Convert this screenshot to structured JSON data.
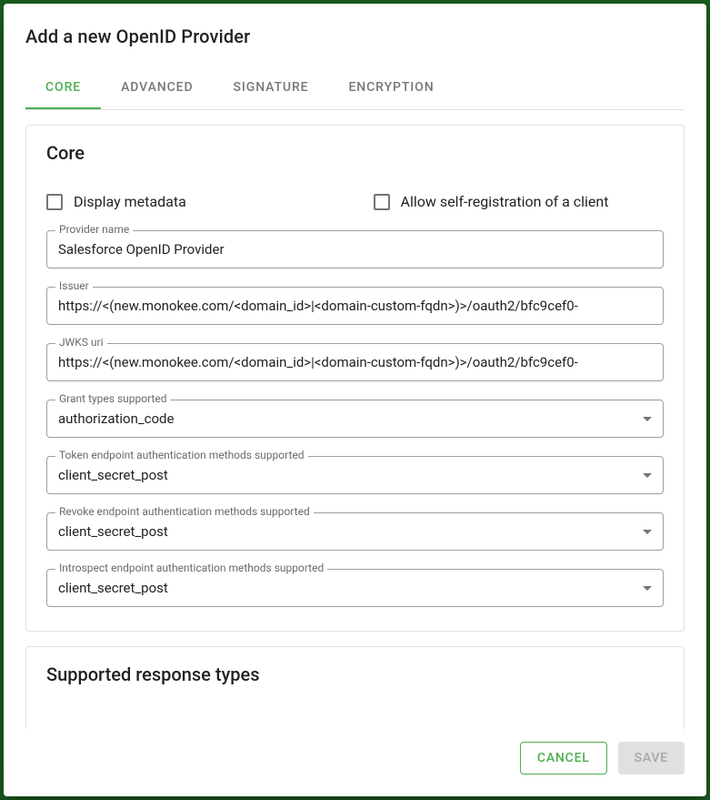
{
  "dialog": {
    "title": "Add a new OpenID Provider"
  },
  "tabs": {
    "core": "Core",
    "advanced": "Advanced",
    "signature": "Signature",
    "encryption": "Encryption"
  },
  "sections": {
    "core": {
      "title": "Core",
      "display_metadata_label": "Display metadata",
      "display_metadata_checked": false,
      "allow_self_registration_label": "Allow self-registration of a client",
      "allow_self_registration_checked": false,
      "provider_name": {
        "label": "Provider name",
        "value": "Salesforce OpenID Provider"
      },
      "issuer": {
        "label": "Issuer",
        "value": "https://<(new.monokee.com/<domain_id>|<domain-custom-fqdn>)>/oauth2/bfc9cef0-"
      },
      "jwks_uri": {
        "label": "JWKS uri",
        "value": "https://<(new.monokee.com/<domain_id>|<domain-custom-fqdn>)>/oauth2/bfc9cef0-"
      },
      "grant_types": {
        "label": "Grant types supported",
        "value": "authorization_code"
      },
      "token_endpoint_auth": {
        "label": "Token endpoint authentication methods supported",
        "value": "client_secret_post"
      },
      "revoke_endpoint_auth": {
        "label": "Revoke endpoint authentication methods supported",
        "value": "client_secret_post"
      },
      "introspect_endpoint_auth": {
        "label": "Introspect endpoint authentication methods supported",
        "value": "client_secret_post"
      }
    },
    "supported_response_types": {
      "title": "Supported response types"
    }
  },
  "actions": {
    "cancel": "Cancel",
    "save": "Save"
  }
}
